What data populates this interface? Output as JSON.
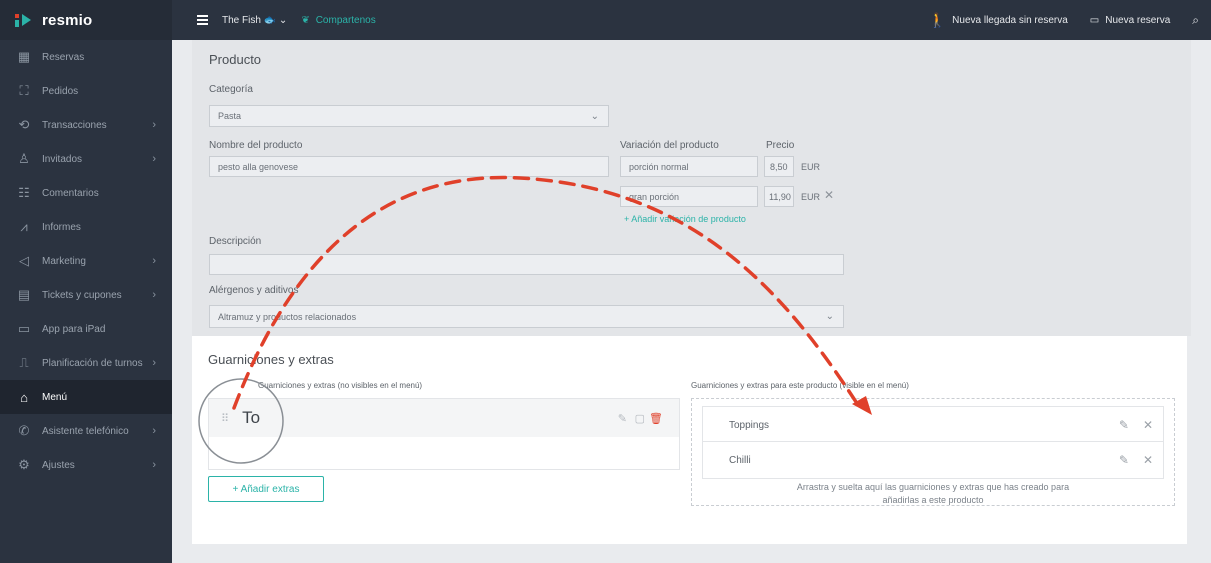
{
  "app": {
    "name": "resmio"
  },
  "sidebar": {
    "items": [
      {
        "label": "Reservas",
        "icon": "calendar-icon",
        "chevron": false
      },
      {
        "label": "Pedidos",
        "icon": "order-icon",
        "chevron": false
      },
      {
        "label": "Transacciones",
        "icon": "transactions-icon",
        "chevron": true
      },
      {
        "label": "Invitados",
        "icon": "guests-icon",
        "chevron": true
      },
      {
        "label": "Comentarios",
        "icon": "comments-icon",
        "chevron": false
      },
      {
        "label": "Informes",
        "icon": "reports-icon",
        "chevron": false
      },
      {
        "label": "Marketing",
        "icon": "marketing-icon",
        "chevron": true
      },
      {
        "label": "Tickets y cupones",
        "icon": "tickets-icon",
        "chevron": true
      },
      {
        "label": "App para iPad",
        "icon": "ipad-icon",
        "chevron": false
      },
      {
        "label": "Planificación de turnos",
        "icon": "shifts-icon",
        "chevron": true
      },
      {
        "label": "Menú",
        "icon": "menu-icon",
        "chevron": false,
        "active": true
      },
      {
        "label": "Asistente telefónico",
        "icon": "phone-assistant-icon",
        "chevron": true
      },
      {
        "label": "Ajustes",
        "icon": "settings-icon",
        "chevron": true
      }
    ]
  },
  "topbar": {
    "venue": "The Fish 🐟",
    "team_link": "Compartenos",
    "walk_in": "Nueva llegada sin reserva",
    "new_reservation": "Nueva reserva"
  },
  "product": {
    "section_title": "Producto",
    "category_label": "Categoría",
    "category_value": "Pasta",
    "name_label": "Nombre del producto",
    "name_value": "pesto alla genovese",
    "variation_label": "Variación del producto",
    "price_label": "Precio",
    "variations": [
      {
        "name": "porción normal",
        "price": "8,50",
        "currency": "EUR"
      },
      {
        "name": "gran porción",
        "price": "11,90",
        "currency": "EUR"
      }
    ],
    "add_variation": "+ Añadir variación de producto",
    "description_label": "Descripción",
    "description_value": "",
    "allergens_label": "Alérgenos y aditivos",
    "allergens_value": "Altramuz y productos relacionados"
  },
  "extras": {
    "section_title": "Guarniciones y extras",
    "available_title": "Guarniciones y extras (no visibles en el menú)",
    "dragging_item": "To",
    "assigned_title": "Guarniciones y extras para este producto (visible en el menú)",
    "assigned": [
      "Toppings",
      "Chilli"
    ],
    "drop_hint_1": "Arrastra y suelta aquí las guarniciones y extras que has creado para",
    "drop_hint_2": "añadirlas a este producto",
    "add_button": "+ Añadir extras"
  },
  "colors": {
    "sidebar_bg": "#2b3340",
    "accent": "#2bb3a8",
    "arrow": "#e0402a"
  }
}
